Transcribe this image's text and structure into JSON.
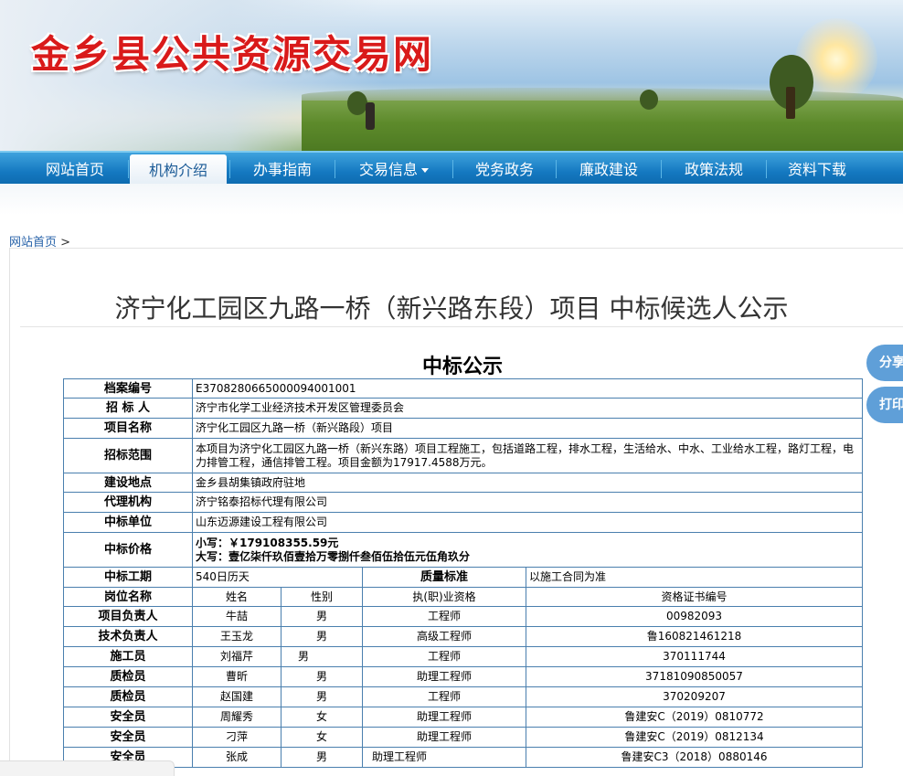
{
  "site": {
    "title": "金乡县公共资源交易网"
  },
  "nav": {
    "items": [
      {
        "label": "网站首页"
      },
      {
        "label": "机构介绍"
      },
      {
        "label": "办事指南"
      },
      {
        "label": "交易信息"
      },
      {
        "label": "党务政务"
      },
      {
        "label": "廉政建设"
      },
      {
        "label": "政策法规"
      },
      {
        "label": "资料下载"
      }
    ],
    "active": "机构介绍"
  },
  "breadcrumb": {
    "home": "网站首页",
    "sep": ">"
  },
  "page": {
    "title": "济宁化工园区九路一桥（新兴路东段）项目 中标候选人公示",
    "section_title": "中标公示"
  },
  "side_buttons": {
    "share": "分享",
    "print": "打印"
  },
  "info": {
    "archive_no": {
      "label": "档案编号",
      "value": "E3708280665000094001001"
    },
    "tenderer": {
      "label": "招 标 人",
      "value": "济宁市化学工业经济技术开发区管理委员会"
    },
    "project_name": {
      "label": "项目名称",
      "value": "济宁化工园区九路一桥（新兴路段）项目"
    },
    "scope": {
      "label": "招标范围",
      "value": "本项目为济宁化工园区九路一桥（新兴东路）项目工程施工，包括道路工程，排水工程，生活给水、中水、工业给水工程，路灯工程，电力排管工程，通信排管工程。项目金额为17917.4588万元。"
    },
    "location": {
      "label": "建设地点",
      "value": "金乡县胡集镇政府驻地"
    },
    "agency": {
      "label": "代理机构",
      "value": "济宁铭泰招标代理有限公司"
    },
    "winner": {
      "label": "中标单位",
      "value": "山东迈源建设工程有限公司"
    },
    "price": {
      "label": "中标价格",
      "small": "小写：￥179108355.59元",
      "big": "大写：壹亿柒仟玖佰壹拾万零捌仟叁佰伍拾伍元伍角玖分"
    },
    "period": {
      "label": "中标工期",
      "value": "540日历天",
      "quality_label": "质量标准",
      "quality_value": "以施工合同为准"
    }
  },
  "staff": {
    "headers": [
      "岗位名称",
      "姓名",
      "性别",
      "执(职)业资格",
      "资格证书编号"
    ],
    "rows": [
      [
        "项目负责人",
        "牛喆",
        "男",
        "工程师",
        "00982093"
      ],
      [
        "技术负责人",
        "王玉龙",
        "男",
        "高级工程师",
        "鲁160821461218"
      ],
      [
        "施工员",
        "刘福芹",
        "男",
        "工程师",
        "370111744"
      ],
      [
        "质检员",
        "曹昕",
        "男",
        "助理工程师",
        "37181090850057"
      ],
      [
        "质检员",
        "赵国建",
        "男",
        "工程师",
        "370209207"
      ],
      [
        "安全员",
        "周耀秀",
        "女",
        "助理工程师",
        "鲁建安C（2019）0810772"
      ],
      [
        "安全员",
        "刁萍",
        "女",
        "助理工程师",
        "鲁建安C（2019）0812134"
      ],
      [
        "安全员",
        "张成",
        "男",
        "助理工程师",
        "鲁建安C3（2018）0880146"
      ]
    ]
  }
}
